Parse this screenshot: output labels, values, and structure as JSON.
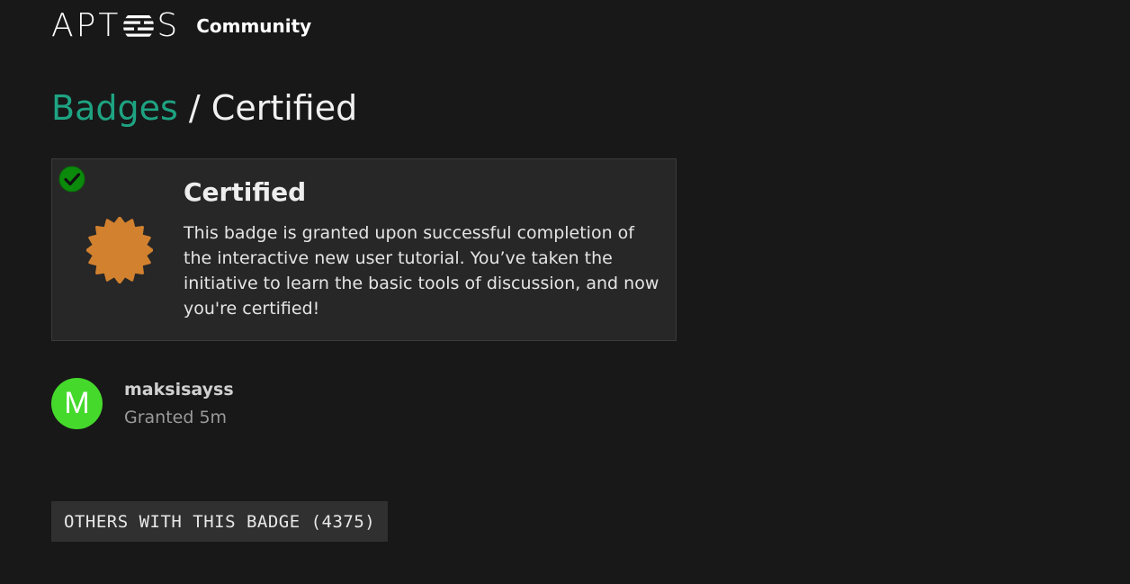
{
  "header": {
    "logo_prefix": "APT",
    "logo_suffix": "S",
    "logo_alt": "APTOS",
    "community_label": "Community"
  },
  "breadcrumb": {
    "parent_label": "Badges",
    "separator": "/",
    "current_label": "Certified"
  },
  "badge": {
    "name": "Certified",
    "description": "This badge is granted upon successful completion of the interactive new user tutorial. You’ve taken the initiative to learn the basic tools of discussion, and now you're certified!",
    "icon": "certificate-badge-icon",
    "icon_color": "#d2812f",
    "granted_indicator": "check-circle-icon",
    "granted_color": "#0b8a0b"
  },
  "grant": {
    "avatar_letter": "M",
    "avatar_color": "#45d92c",
    "username": "maksisayss",
    "granted_text": "Granted 5m"
  },
  "others": {
    "heading": "OTHERS WITH THIS BADGE (4375)"
  },
  "colors": {
    "background": "#181818",
    "accent": "#1ea382",
    "card": "#272727"
  }
}
